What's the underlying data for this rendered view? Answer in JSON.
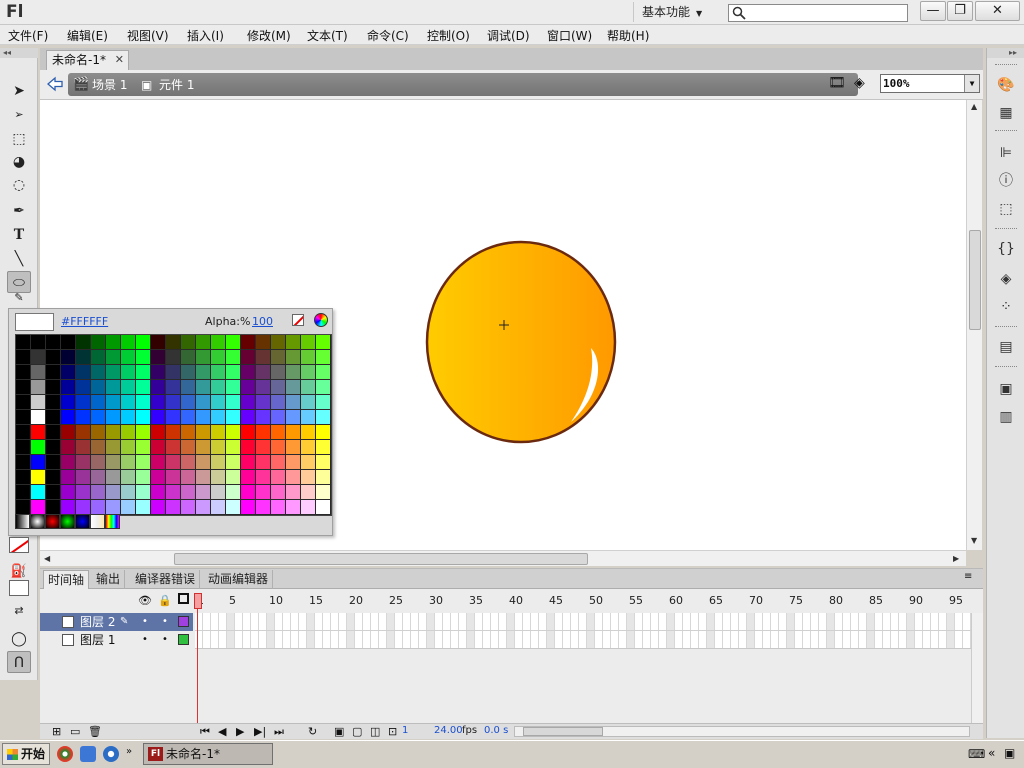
{
  "app": {
    "logo": "Fl",
    "workspace": "基本功能",
    "search_placeholder": "",
    "window_buttons": {
      "minimize": "—",
      "restore": "❐",
      "close": "✕"
    }
  },
  "menu": [
    "文件(F)",
    "编辑(E)",
    "视图(V)",
    "插入(I)",
    "修改(M)",
    "文本(T)",
    "命令(C)",
    "控制(O)",
    "调试(D)",
    "窗口(W)",
    "帮助(H)"
  ],
  "document": {
    "tab_title": "未命名-1*",
    "breadcrumb": [
      "场景 1",
      "元件 1"
    ],
    "zoom": "100%"
  },
  "swatch_panel": {
    "hex": "#FFFFFF",
    "alpha_label": "Alpha:%",
    "alpha_value": "100",
    "preview_color": "#FFFFFF"
  },
  "timeline": {
    "tabs": [
      "时间轴",
      "输出",
      "编译器错误",
      "动画编辑器"
    ],
    "frame_numbers": [
      "1",
      "5",
      "10",
      "15",
      "20",
      "25",
      "30",
      "35",
      "40",
      "45",
      "50",
      "55",
      "60",
      "65",
      "70",
      "75",
      "80",
      "85",
      "90",
      "95"
    ],
    "layers": [
      {
        "name": "图层 2",
        "color": "#a040e0",
        "selected": true
      },
      {
        "name": "图层 1",
        "color": "#30c040",
        "selected": false
      }
    ],
    "current_frame": "1",
    "fps": "24.00",
    "fps_unit": "fps",
    "time": "0.0 s"
  },
  "taskbar": {
    "start": "开始",
    "task": "未命名-1*",
    "task_icon": "Fl"
  },
  "colors": {
    "ball_light": "#ffcc00",
    "ball_dark": "#ff9900",
    "ball_stroke": "#6b2a10",
    "layer_selected": "#5e73a6"
  }
}
